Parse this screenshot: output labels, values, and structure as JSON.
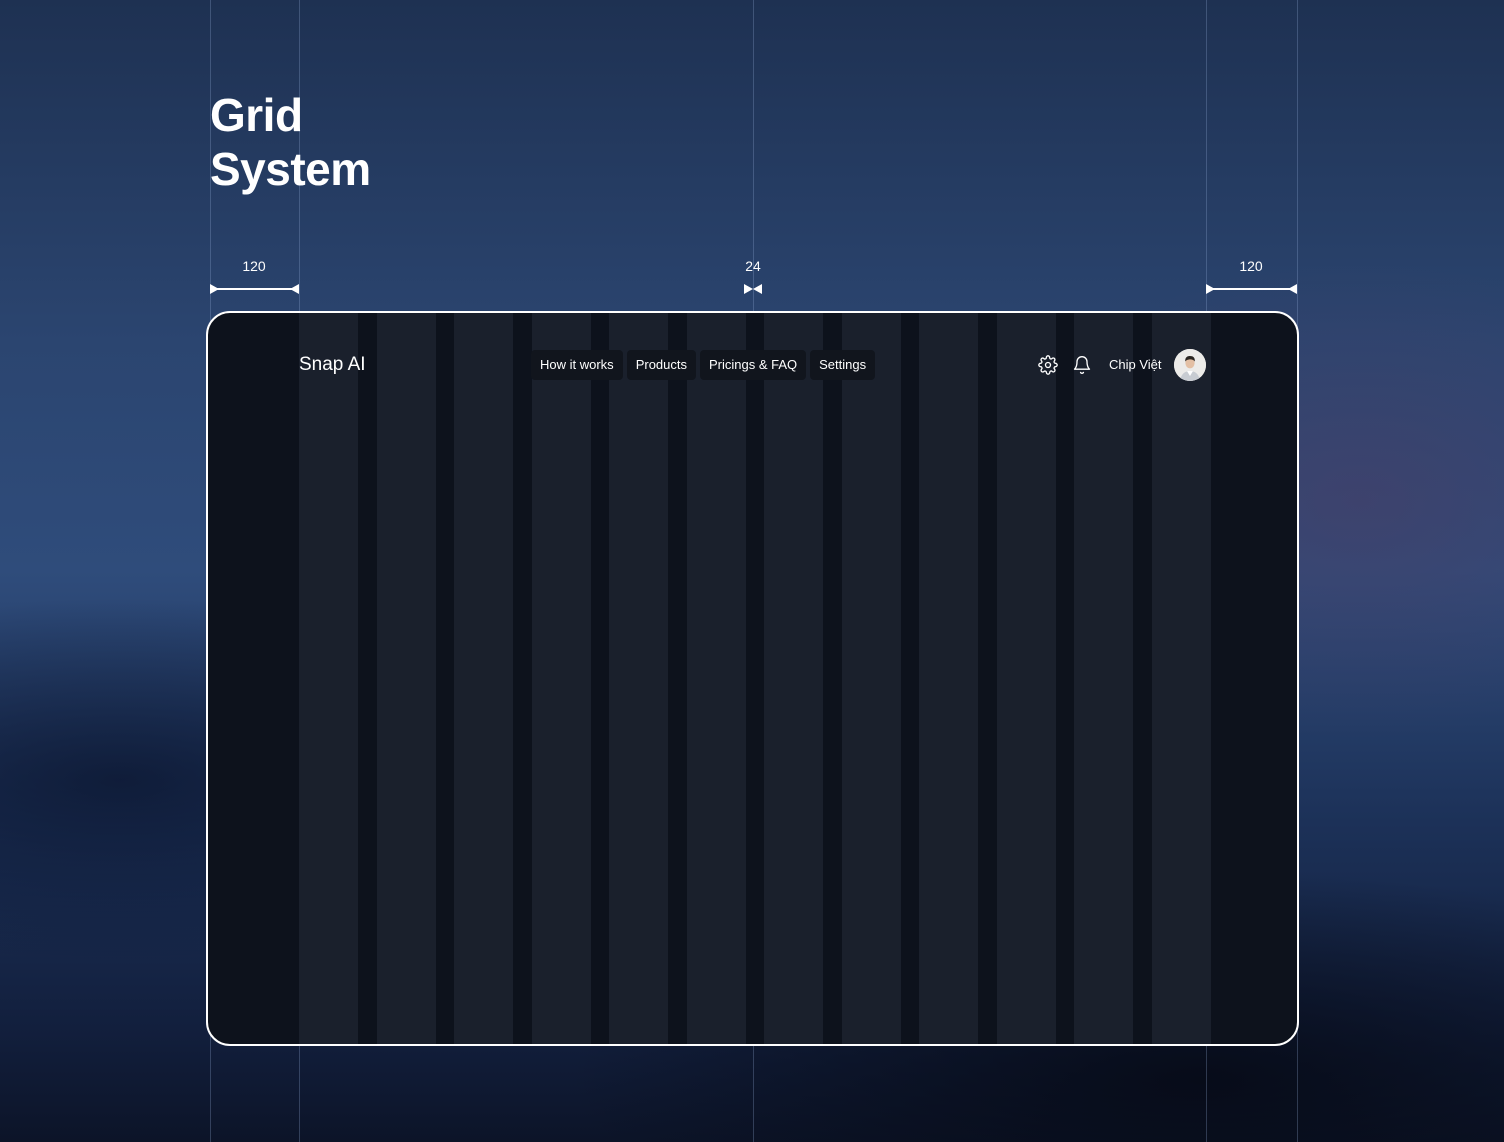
{
  "page": {
    "title_lines": [
      "Grid",
      "System"
    ]
  },
  "measurements": {
    "left_margin": "120",
    "gutter": "24",
    "right_margin": "120"
  },
  "app": {
    "logo": "Snap AI",
    "menu": [
      {
        "label": "How it works"
      },
      {
        "label": "Products"
      },
      {
        "label": "Pricings & FAQ"
      },
      {
        "label": "Settings"
      }
    ],
    "icons": {
      "settings": "gear-icon",
      "notifications": "bell-icon",
      "avatar": "user-avatar"
    },
    "user_name": "Chip Việt"
  },
  "colors": {
    "frame_bg": "#0d121c",
    "column": "#1a202c",
    "menu_item_bg": "#11151d",
    "text": "#ffffff"
  }
}
